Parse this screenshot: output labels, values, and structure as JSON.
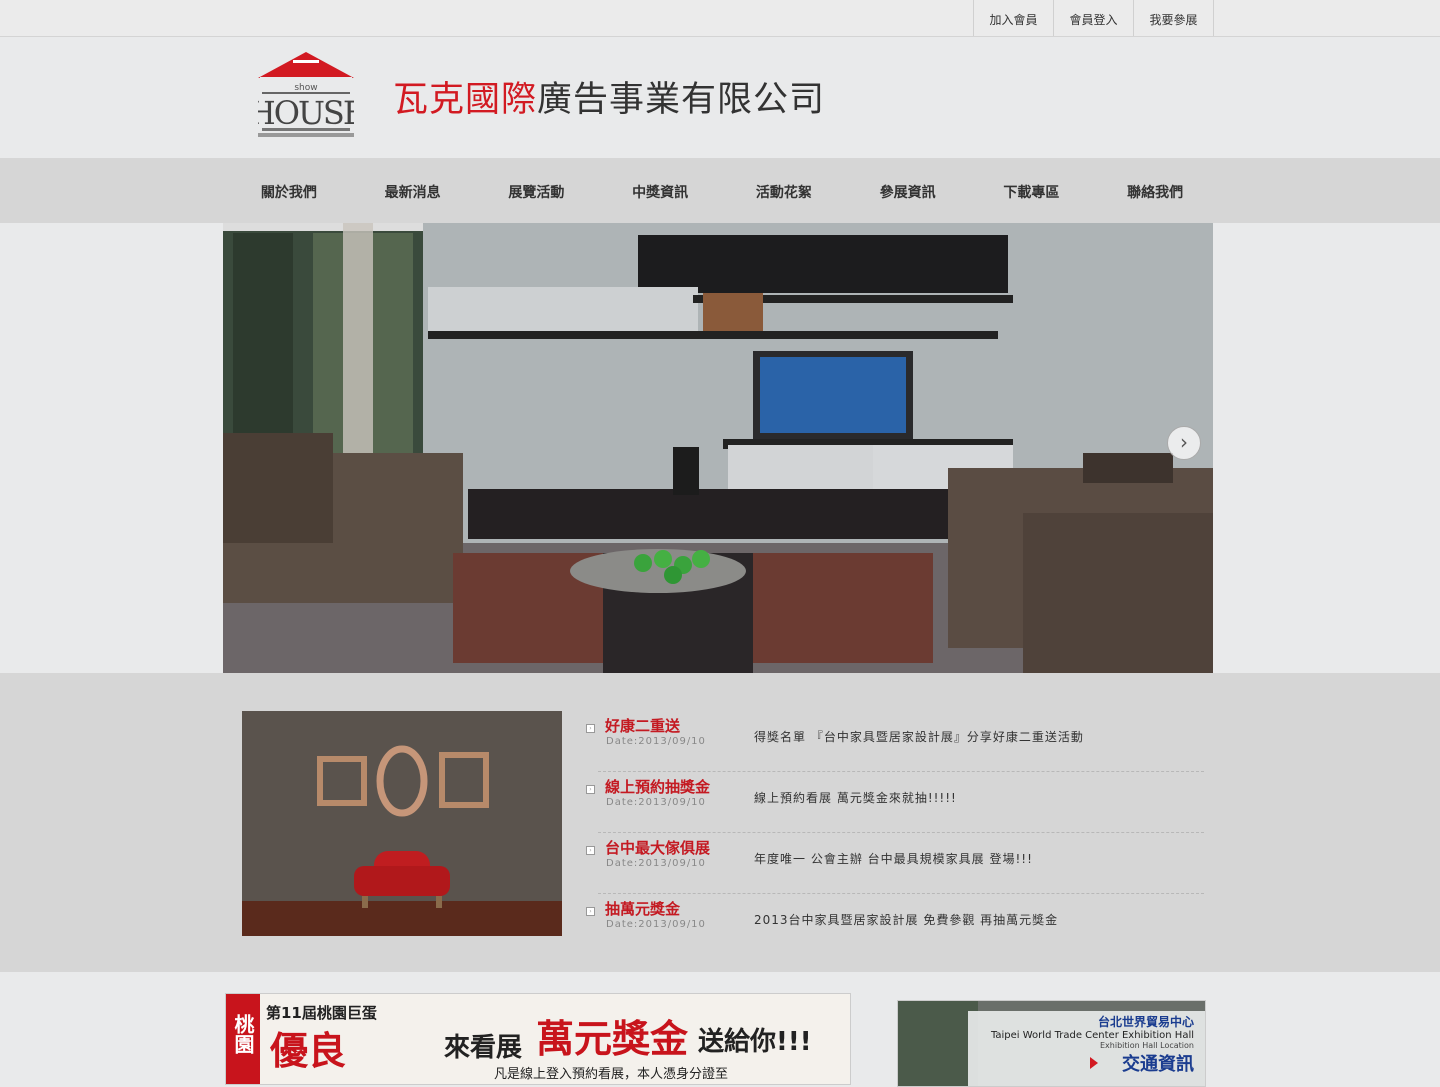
{
  "top_links": [
    "加入會員",
    "會員登入",
    "我要參展"
  ],
  "logo": {
    "small_word": "show",
    "big_word": "HOUSE"
  },
  "company": {
    "red_part": "瓦克國際",
    "dark_part": "廣告事業有限公司"
  },
  "nav": [
    "關於我們",
    "最新消息",
    "展覽活動",
    "中獎資訊",
    "活動花絮",
    "參展資訊",
    "下載專區",
    "聯絡我們"
  ],
  "hero": {
    "next_arrow": "›"
  },
  "news": [
    {
      "title": "好康二重送",
      "date": "Date:2013/09/10",
      "desc": "得獎名單 『台中家具暨居家設計展』分享好康二重送活動"
    },
    {
      "title": "線上預約抽獎金",
      "date": "Date:2013/09/10",
      "desc": "線上預約看展 萬元獎金來就抽!!!!!"
    },
    {
      "title": "台中最大傢俱展",
      "date": "Date:2013/09/10",
      "desc": "年度唯一 公會主辦 台中最具規模家具展 登場!!!"
    },
    {
      "title": "抽萬元獎金",
      "date": "Date:2013/09/10",
      "desc": "2013台中家具暨居家設計展 免費參觀 再抽萬元獎金"
    }
  ],
  "banner_left": {
    "vertical_text": "桃園",
    "edition": "第11屆桃園巨蛋",
    "big_text": "優良",
    "come": "來看展",
    "prize": "萬元獎金",
    "send": "送給你!!!",
    "note": "凡是線上登入預約看展，本人憑身分證至"
  },
  "banner_right": {
    "title": "台北世界貿易中心",
    "subtitle": "Taipei World Trade Center Exhibition Hall",
    "sub2": "Exhibition Hall Location",
    "traffic": "交通資訊"
  },
  "colors": {
    "brand_red": "#d21a22",
    "background": "#e9eaeb",
    "nav_band": "#d6d6d6"
  }
}
